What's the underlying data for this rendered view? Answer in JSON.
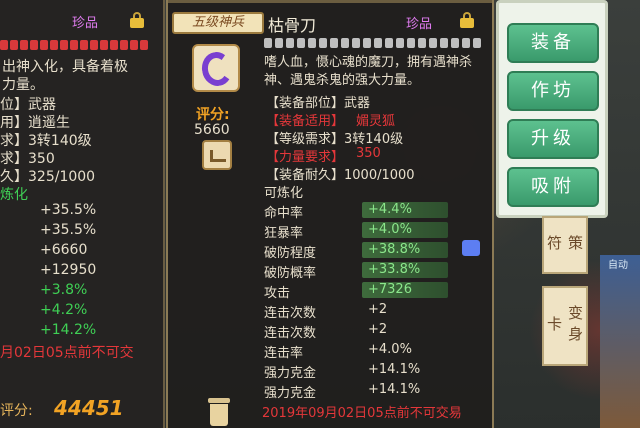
{
  "left_card": {
    "rarity": "珍品",
    "desc_line1": "出神入化，具备着极",
    "desc_line2": "力量。",
    "fields": [
      "位】武器",
      "用】逍遥生",
      "求】3转140级",
      "求】350",
      "久】325/1000"
    ],
    "refine_label": "炼化",
    "bonuses": [
      "+35.5%",
      "+35.5%",
      "+6660",
      "+12950",
      "+3.8%",
      "+4.2%",
      "+14.2%"
    ],
    "untradeable": "月02日05点前不可交",
    "score_label": "评分:",
    "score_value": "44451"
  },
  "main_card": {
    "level_badge": "五级神兵",
    "item_name": "枯骨刀",
    "rarity": "珍品",
    "description": "嗜人血，慑心魂的魔刀，拥有遇神杀神、遇鬼杀鬼的强大力量。",
    "score_label": "评分:",
    "score_value": "5660",
    "equip_part": "【装备部位】武器",
    "equip_for_label": "【装备适用】",
    "equip_for_value": "媚灵狐",
    "level_req": "【等级需求】3转140级",
    "str_req_label": "【力量要求】",
    "str_req_value": "350",
    "durability": "【装备耐久】1000/1000",
    "refine_title": "可炼化",
    "refine_stats": [
      {
        "name": "命中率",
        "value": "+4.4%"
      },
      {
        "name": "狂暴率",
        "value": "+4.0%"
      },
      {
        "name": "破防程度",
        "value": "+38.8%"
      },
      {
        "name": "破防概率",
        "value": "+33.8%"
      },
      {
        "name": "攻击",
        "value": "+7326"
      }
    ],
    "extra_stats": [
      {
        "name": "连击次数",
        "value": "+2"
      },
      {
        "name": "连击次数",
        "value": "+2"
      },
      {
        "name": "连击率",
        "value": "+4.0%"
      },
      {
        "name": "强力克金",
        "value": "+14.1%"
      },
      {
        "name": "强力克金",
        "value": "+14.1%"
      }
    ],
    "untradeable": "2019年09月02日05点前不可交易"
  },
  "actions": [
    "装备",
    "作坊",
    "升级",
    "吸附"
  ],
  "side_tabs": [
    "策符",
    "变身卡"
  ],
  "corner": "自动"
}
